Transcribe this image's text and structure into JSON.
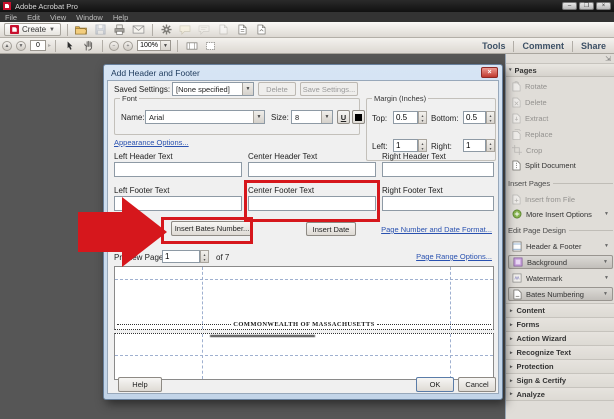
{
  "colors": {
    "annotation_red": "#d6171c",
    "link_blue": "#2a52b0"
  },
  "window": {
    "title": "Adobe Acrobat Pro"
  },
  "menubar": {
    "items": [
      "File",
      "Edit",
      "View",
      "Window",
      "Help"
    ]
  },
  "toolbar": {
    "create_label": "Create",
    "page_number": "0",
    "zoom_level": "100%"
  },
  "nav_tabs": {
    "tools": "Tools",
    "comment": "Comment",
    "share": "Share"
  },
  "right_panel": {
    "pages_header": "Pages",
    "rotate": "Rotate",
    "delete": "Delete",
    "extract": "Extract",
    "replace": "Replace",
    "crop": "Crop",
    "split_document": "Split Document",
    "insert_pages_header": "Insert Pages",
    "insert_from_file": "Insert from File",
    "more_insert_options": "More Insert Options",
    "edit_page_design_header": "Edit Page Design",
    "header_footer": "Header & Footer",
    "background": "Background",
    "watermark": "Watermark",
    "bates_numbering": "Bates Numbering",
    "collapsed_sections": [
      "Content",
      "Forms",
      "Action Wizard",
      "Recognize Text",
      "Protection",
      "Sign & Certify",
      "Analyze"
    ]
  },
  "dialog": {
    "title": "Add Header and Footer",
    "saved_settings_label": "Saved Settings:",
    "saved_settings_value": "[None specified]",
    "delete_button": "Delete",
    "save_settings_button": "Save Settings...",
    "font_group_label": "Font",
    "name_label": "Name:",
    "name_value": "Arial",
    "size_label": "Size:",
    "size_value": "8",
    "underline_button": "U",
    "margin_group_label": "Margin (Inches)",
    "top_label": "Top:",
    "top_value": "0.5",
    "bottom_label": "Bottom:",
    "bottom_value": "0.5",
    "left_label": "Left:",
    "left_value": "1",
    "right_label": "Right:",
    "right_value": "1",
    "appearance_options_link": "Appearance Options...",
    "left_header_label": "Left Header Text",
    "center_header_label": "Center Header Text",
    "right_header_label": "Right Header Text",
    "left_footer_label": "Left Footer Text",
    "center_footer_label": "Center Footer Text",
    "right_footer_label": "Right Footer Text",
    "insert_bates_button": "Insert Bates Number...",
    "insert_date_button": "Insert Date",
    "page_number_date_format_link": "Page Number and Date Format...",
    "preview_page_label": "Preview Page",
    "preview_page_value": "1",
    "preview_of_label": "of 7",
    "page_range_options_link": "Page Range Options...",
    "preview_document_text": "COMMONWEALTH OF MASSACHUSETTS",
    "help_button": "Help",
    "ok_button": "OK",
    "cancel_button": "Cancel"
  }
}
